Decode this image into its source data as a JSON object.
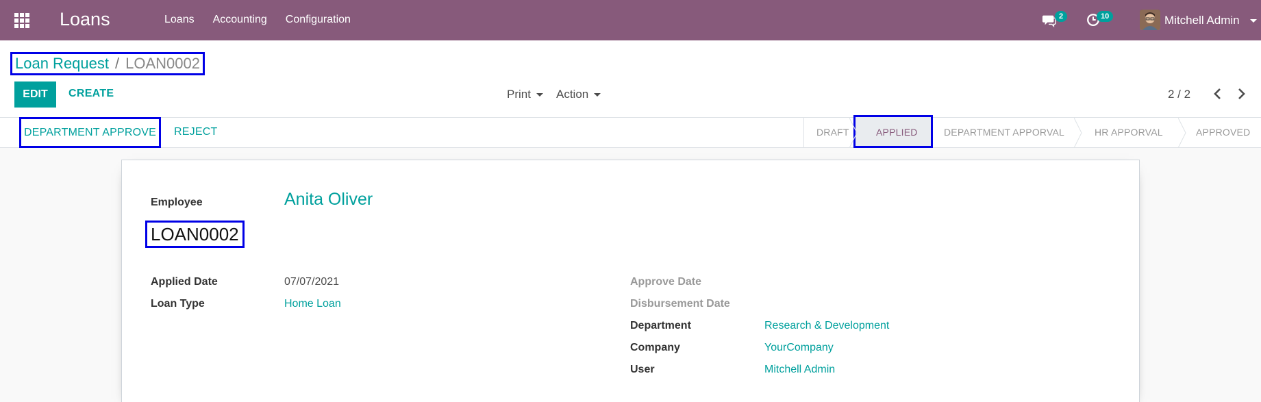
{
  "navbar": {
    "brand": "Loans",
    "menu": [
      "Loans",
      "Accounting",
      "Configuration"
    ],
    "messages_count": "2",
    "activities_count": "10",
    "user_name": "Mitchell Admin"
  },
  "breadcrumb": {
    "parent": "Loan Request",
    "separator": "/",
    "current": "LOAN0002"
  },
  "toolbar": {
    "edit_label": "EDIT",
    "create_label": "CREATE",
    "print_label": "Print",
    "action_label": "Action",
    "pager": "2 / 2"
  },
  "statusbar": {
    "dept_approve_label": "DEPARTMENT APPROVE",
    "reject_label": "REJECT",
    "stages": [
      "DRAFT",
      "APPLIED",
      "DEPARTMENT APPORVAL",
      "HR APPORVAL",
      "APPROVED"
    ],
    "active_stage": "APPLIED"
  },
  "form": {
    "employee_label": "Employee",
    "employee_value": "Anita Oliver",
    "loan_name": "LOAN0002",
    "applied_date_label": "Applied Date",
    "applied_date_value": "07/07/2021",
    "loan_type_label": "Loan Type",
    "loan_type_value": "Home Loan",
    "approve_date_label": "Approve Date",
    "disbursement_date_label": "Disbursement Date",
    "department_label": "Department",
    "department_value": "Research & Development",
    "company_label": "Company",
    "company_value": "YourCompany",
    "user_label": "User",
    "user_value": "Mitchell Admin"
  },
  "colors": {
    "navbar": "#875a7b",
    "accent": "#00a09d",
    "highlight_border": "#0000e6"
  }
}
